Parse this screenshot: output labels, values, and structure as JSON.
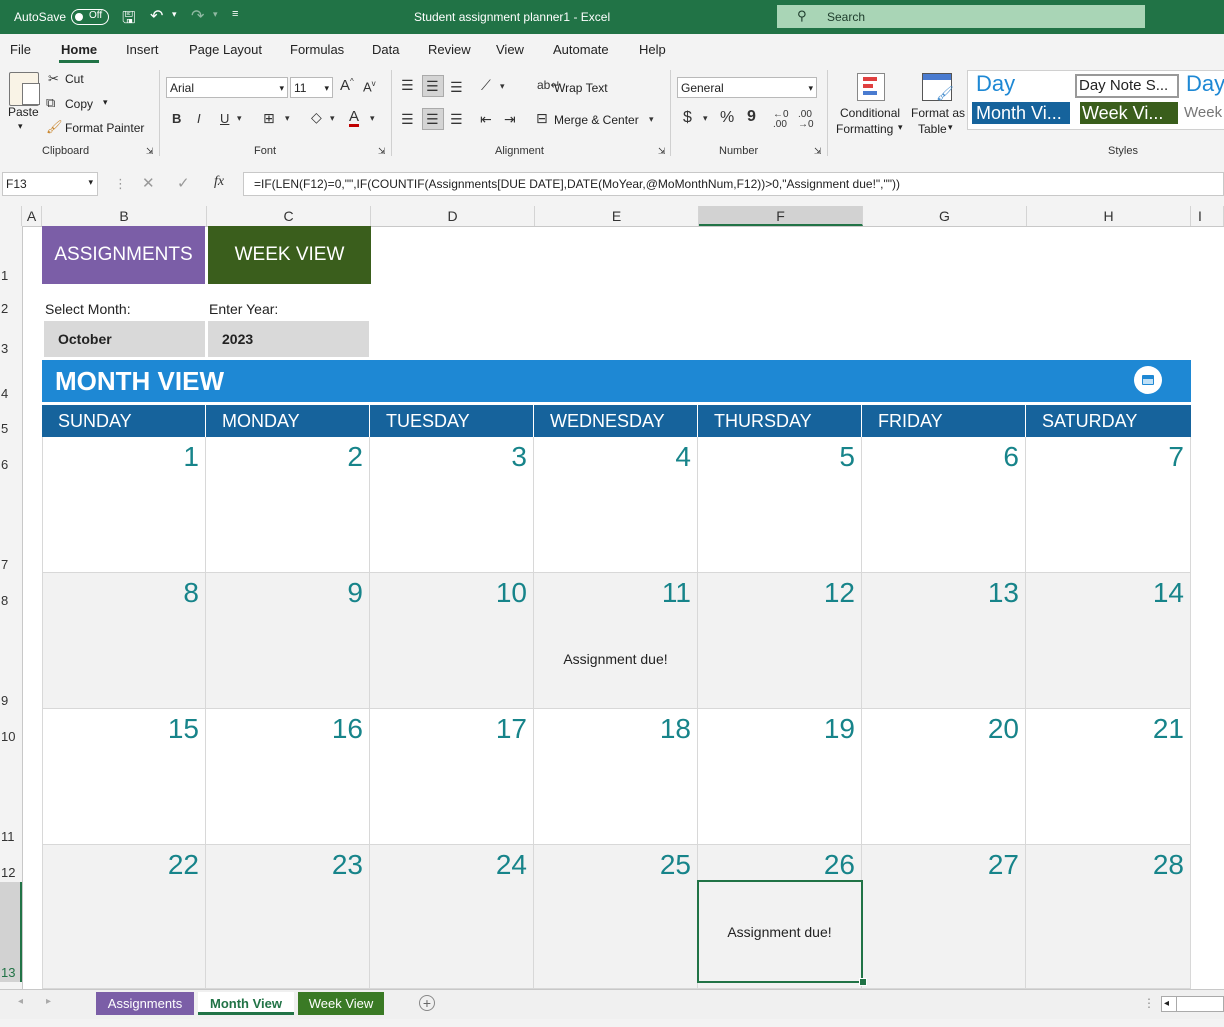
{
  "titlebar": {
    "autosave_label": "AutoSave",
    "autosave_state": "Off",
    "doc_title": "Student assignment planner1  -  Excel",
    "search_placeholder": "Search",
    "color": "#217346"
  },
  "menu": [
    "File",
    "Home",
    "Insert",
    "Page Layout",
    "Formulas",
    "Data",
    "Review",
    "View",
    "Automate",
    "Help"
  ],
  "menu_active": "Home",
  "ribbon": {
    "clipboard": {
      "paste": "Paste",
      "cut": "Cut",
      "copy": "Copy",
      "format_painter": "Format Painter",
      "group": "Clipboard"
    },
    "font": {
      "name": "Arial",
      "size": "11",
      "bold": "B",
      "italic": "I",
      "underline": "U",
      "group": "Font"
    },
    "alignment": {
      "wrap": "Wrap Text",
      "merge": "Merge & Center",
      "group": "Alignment"
    },
    "number": {
      "format": "General",
      "currency": "$",
      "percent": "%",
      "comma": "9",
      "group": "Number"
    },
    "styles": {
      "conditional_1": "Conditional",
      "conditional_2": "Formatting",
      "format_table_1": "Format as",
      "format_table_2": "Table",
      "group": "Styles",
      "gallery": [
        "Day",
        "Day Note S...",
        "Day",
        "Month Vi...",
        "Week Vi...",
        "Week"
      ]
    }
  },
  "formula_bar": {
    "name_box": "F13",
    "fx": "fx",
    "formula": "=IF(LEN(F12)=0,\"\",IF(COUNTIF(Assignments[DUE DATE],DATE(MoYear,@MoMonthNum,F12))>0,\"Assignment due!\",\"\"))"
  },
  "columns": [
    "A",
    "B",
    "C",
    "D",
    "E",
    "F",
    "G",
    "H",
    "I"
  ],
  "rows": [
    "1",
    "2",
    "3",
    "4",
    "5",
    "6",
    "7",
    "8",
    "9",
    "10",
    "11",
    "12",
    "13"
  ],
  "sheet": {
    "assignments_btn": "ASSIGNMENTS",
    "weekview_btn": "WEEK VIEW",
    "select_month_label": "Select Month:",
    "enter_year_label": "Enter Year:",
    "month_value": "October",
    "year_value": "2023",
    "month_view_title": "MONTH VIEW",
    "days": [
      "SUNDAY",
      "MONDAY",
      "TUESDAY",
      "WEDNESDAY",
      "THURSDAY",
      "FRIDAY",
      "SATURDAY"
    ],
    "weeks": [
      [
        "1",
        "2",
        "3",
        "4",
        "5",
        "6",
        "7"
      ],
      [
        "8",
        "9",
        "10",
        "11",
        "12",
        "13",
        "14"
      ],
      [
        "15",
        "16",
        "17",
        "18",
        "19",
        "20",
        "21"
      ],
      [
        "22",
        "23",
        "24",
        "25",
        "26",
        "27",
        "28"
      ]
    ],
    "note": "Assignment due!",
    "colors": {
      "purple": "#7b5ea7",
      "green": "#3a5e1c",
      "blue": "#1e88d4",
      "navy": "#16639c",
      "teal": "#17848a"
    }
  },
  "tabs": [
    "Assignments",
    "Month View",
    "Week View"
  ],
  "active_tab": "Month View"
}
